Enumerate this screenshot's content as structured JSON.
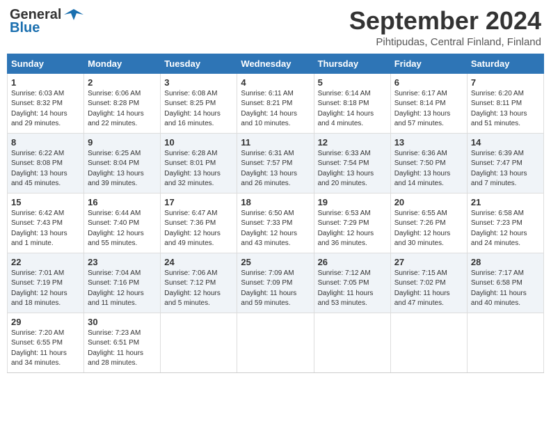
{
  "header": {
    "logo_general": "General",
    "logo_blue": "Blue",
    "title": "September 2024",
    "location": "Pihtipudas, Central Finland, Finland"
  },
  "weekdays": [
    "Sunday",
    "Monday",
    "Tuesday",
    "Wednesday",
    "Thursday",
    "Friday",
    "Saturday"
  ],
  "weeks": [
    [
      {
        "day": "1",
        "info": "Sunrise: 6:03 AM\nSunset: 8:32 PM\nDaylight: 14 hours\nand 29 minutes."
      },
      {
        "day": "2",
        "info": "Sunrise: 6:06 AM\nSunset: 8:28 PM\nDaylight: 14 hours\nand 22 minutes."
      },
      {
        "day": "3",
        "info": "Sunrise: 6:08 AM\nSunset: 8:25 PM\nDaylight: 14 hours\nand 16 minutes."
      },
      {
        "day": "4",
        "info": "Sunrise: 6:11 AM\nSunset: 8:21 PM\nDaylight: 14 hours\nand 10 minutes."
      },
      {
        "day": "5",
        "info": "Sunrise: 6:14 AM\nSunset: 8:18 PM\nDaylight: 14 hours\nand 4 minutes."
      },
      {
        "day": "6",
        "info": "Sunrise: 6:17 AM\nSunset: 8:14 PM\nDaylight: 13 hours\nand 57 minutes."
      },
      {
        "day": "7",
        "info": "Sunrise: 6:20 AM\nSunset: 8:11 PM\nDaylight: 13 hours\nand 51 minutes."
      }
    ],
    [
      {
        "day": "8",
        "info": "Sunrise: 6:22 AM\nSunset: 8:08 PM\nDaylight: 13 hours\nand 45 minutes."
      },
      {
        "day": "9",
        "info": "Sunrise: 6:25 AM\nSunset: 8:04 PM\nDaylight: 13 hours\nand 39 minutes."
      },
      {
        "day": "10",
        "info": "Sunrise: 6:28 AM\nSunset: 8:01 PM\nDaylight: 13 hours\nand 32 minutes."
      },
      {
        "day": "11",
        "info": "Sunrise: 6:31 AM\nSunset: 7:57 PM\nDaylight: 13 hours\nand 26 minutes."
      },
      {
        "day": "12",
        "info": "Sunrise: 6:33 AM\nSunset: 7:54 PM\nDaylight: 13 hours\nand 20 minutes."
      },
      {
        "day": "13",
        "info": "Sunrise: 6:36 AM\nSunset: 7:50 PM\nDaylight: 13 hours\nand 14 minutes."
      },
      {
        "day": "14",
        "info": "Sunrise: 6:39 AM\nSunset: 7:47 PM\nDaylight: 13 hours\nand 7 minutes."
      }
    ],
    [
      {
        "day": "15",
        "info": "Sunrise: 6:42 AM\nSunset: 7:43 PM\nDaylight: 13 hours\nand 1 minute."
      },
      {
        "day": "16",
        "info": "Sunrise: 6:44 AM\nSunset: 7:40 PM\nDaylight: 12 hours\nand 55 minutes."
      },
      {
        "day": "17",
        "info": "Sunrise: 6:47 AM\nSunset: 7:36 PM\nDaylight: 12 hours\nand 49 minutes."
      },
      {
        "day": "18",
        "info": "Sunrise: 6:50 AM\nSunset: 7:33 PM\nDaylight: 12 hours\nand 43 minutes."
      },
      {
        "day": "19",
        "info": "Sunrise: 6:53 AM\nSunset: 7:29 PM\nDaylight: 12 hours\nand 36 minutes."
      },
      {
        "day": "20",
        "info": "Sunrise: 6:55 AM\nSunset: 7:26 PM\nDaylight: 12 hours\nand 30 minutes."
      },
      {
        "day": "21",
        "info": "Sunrise: 6:58 AM\nSunset: 7:23 PM\nDaylight: 12 hours\nand 24 minutes."
      }
    ],
    [
      {
        "day": "22",
        "info": "Sunrise: 7:01 AM\nSunset: 7:19 PM\nDaylight: 12 hours\nand 18 minutes."
      },
      {
        "day": "23",
        "info": "Sunrise: 7:04 AM\nSunset: 7:16 PM\nDaylight: 12 hours\nand 11 minutes."
      },
      {
        "day": "24",
        "info": "Sunrise: 7:06 AM\nSunset: 7:12 PM\nDaylight: 12 hours\nand 5 minutes."
      },
      {
        "day": "25",
        "info": "Sunrise: 7:09 AM\nSunset: 7:09 PM\nDaylight: 11 hours\nand 59 minutes."
      },
      {
        "day": "26",
        "info": "Sunrise: 7:12 AM\nSunset: 7:05 PM\nDaylight: 11 hours\nand 53 minutes."
      },
      {
        "day": "27",
        "info": "Sunrise: 7:15 AM\nSunset: 7:02 PM\nDaylight: 11 hours\nand 47 minutes."
      },
      {
        "day": "28",
        "info": "Sunrise: 7:17 AM\nSunset: 6:58 PM\nDaylight: 11 hours\nand 40 minutes."
      }
    ],
    [
      {
        "day": "29",
        "info": "Sunrise: 7:20 AM\nSunset: 6:55 PM\nDaylight: 11 hours\nand 34 minutes."
      },
      {
        "day": "30",
        "info": "Sunrise: 7:23 AM\nSunset: 6:51 PM\nDaylight: 11 hours\nand 28 minutes."
      },
      {
        "day": "",
        "info": ""
      },
      {
        "day": "",
        "info": ""
      },
      {
        "day": "",
        "info": ""
      },
      {
        "day": "",
        "info": ""
      },
      {
        "day": "",
        "info": ""
      }
    ]
  ]
}
